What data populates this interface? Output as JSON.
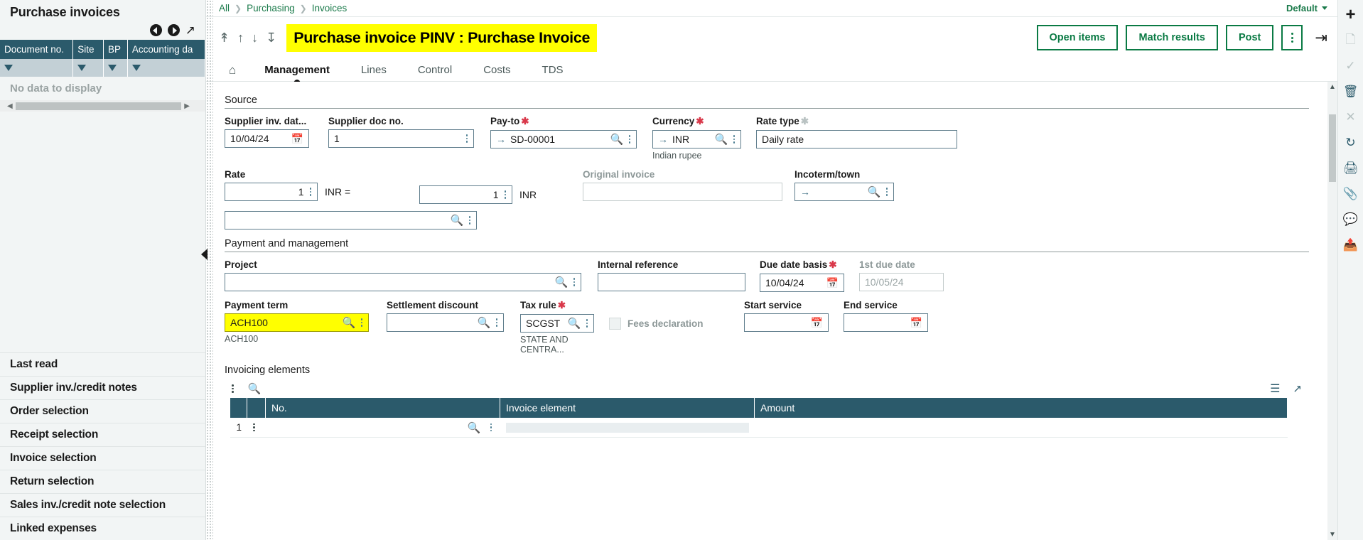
{
  "left_panel": {
    "title": "Purchase invoices",
    "nav": {
      "prev_icon": "circle-left-arrow-icon",
      "next_icon": "circle-right-arrow-icon",
      "expand_icon": "expand-diagonal-icon"
    },
    "grid_columns": [
      "Document no.",
      "Site",
      "BP",
      "Accounting da"
    ],
    "no_data_text": "No data to display",
    "nav_items": [
      "Last read",
      "Supplier inv./credit notes",
      "Order selection",
      "Receipt selection",
      "Invoice selection",
      "Return selection",
      "Sales inv./credit note selection",
      "Linked expenses"
    ]
  },
  "topbar": {
    "breadcrumb": [
      "All",
      "Purchasing",
      "Invoices"
    ],
    "view_selector": "Default"
  },
  "header": {
    "title": "Purchase invoice PINV : Purchase Invoice",
    "nav_arrows": [
      "first-record-icon",
      "previous-record-icon",
      "next-record-icon",
      "last-record-icon"
    ],
    "buttons": [
      "Open items",
      "Match results",
      "Post"
    ],
    "more_icon": "kebab-menu-icon",
    "exit_icon": "exit-icon"
  },
  "tabs": [
    {
      "label": "",
      "icon": "home-icon",
      "active": false
    },
    {
      "label": "Management",
      "active": true
    },
    {
      "label": "Lines",
      "active": false
    },
    {
      "label": "Control",
      "active": false
    },
    {
      "label": "Costs",
      "active": false
    },
    {
      "label": "TDS",
      "active": false
    }
  ],
  "source": {
    "section_title": "Source",
    "supplier_inv_date": {
      "label": "Supplier inv. dat...",
      "value": "10/04/24"
    },
    "supplier_doc_no": {
      "label": "Supplier doc no.",
      "value": "1"
    },
    "pay_to": {
      "label": "Pay-to",
      "required": true,
      "value": "SD-00001"
    },
    "currency": {
      "label": "Currency",
      "required": true,
      "value": "INR",
      "hint": "Indian rupee"
    },
    "rate_type": {
      "label": "Rate type",
      "value": "Daily rate"
    },
    "rate": {
      "label": "Rate",
      "value": "1",
      "equals_label": "INR =",
      "value2": "1",
      "unit": "INR"
    },
    "original_invoice": {
      "label": "Original invoice",
      "value": ""
    },
    "incoterm_town": {
      "label": "Incoterm/town",
      "value": ""
    },
    "extra_lookup": {
      "value": ""
    }
  },
  "payment": {
    "section_title": "Payment and management",
    "project": {
      "label": "Project",
      "value": ""
    },
    "internal_reference": {
      "label": "Internal reference",
      "value": ""
    },
    "due_date_basis": {
      "label": "Due date basis",
      "required": true,
      "value": "10/04/24"
    },
    "first_due_date": {
      "label": "1st due date",
      "value": "10/05/24"
    },
    "payment_term": {
      "label": "Payment term",
      "value": "ACH100",
      "hint": "ACH100",
      "highlighted": true
    },
    "settlement_discount": {
      "label": "Settlement discount",
      "value": ""
    },
    "tax_rule": {
      "label": "Tax rule",
      "required": true,
      "value": "SCGST",
      "hint": "STATE AND CENTRA..."
    },
    "fees_declaration": {
      "label": "Fees declaration",
      "checked": false
    },
    "start_service": {
      "label": "Start service",
      "value": ""
    },
    "end_service": {
      "label": "End service",
      "value": ""
    }
  },
  "invoicing_elements": {
    "section_title": "Invoicing elements",
    "toolbar": {
      "menu_icon": "kebab-menu-icon",
      "search_icon": "search-icon",
      "layers_icon": "layers-icon",
      "expand_icon": "expand-icon"
    },
    "columns": [
      "",
      "",
      "No.",
      "Invoice element",
      "Amount"
    ],
    "rows": [
      {
        "num": "1",
        "no": "",
        "invoice_element": "",
        "amount": ""
      }
    ]
  },
  "right_rail": {
    "icons": [
      "add-icon",
      "copy-icon",
      "check-icon",
      "trash-icon",
      "cancel-icon",
      "refresh-icon",
      "print-icon",
      "attachment-icon",
      "comment-icon",
      "share-icon"
    ]
  },
  "colors": {
    "accent_green": "#0a7a44",
    "header_teal": "#2b5a6b",
    "highlight_yellow": "#ffff00",
    "required_red": "#d9384a"
  }
}
